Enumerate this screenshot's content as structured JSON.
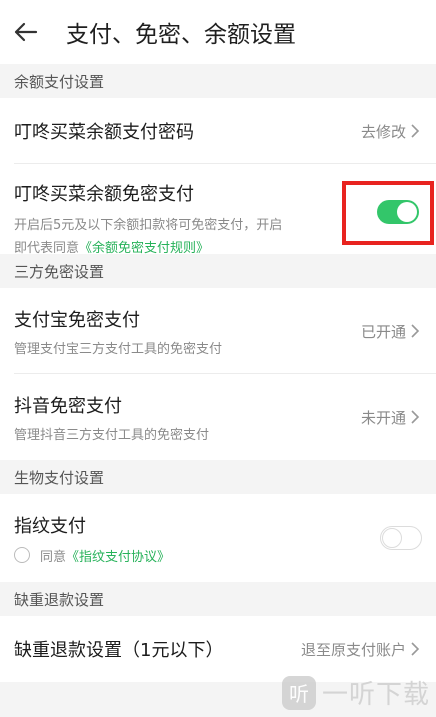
{
  "header": {
    "title": "支付、免密、余额设置",
    "back_icon": "back-arrow-icon"
  },
  "sections": {
    "balance": {
      "label": "余额支付设置",
      "password_row": {
        "title": "叮咚买菜余额支付密码",
        "action": "去修改"
      },
      "free_pay_row": {
        "title": "叮咚买菜余额免密支付",
        "sub_line1": "开启后5元及以下余额扣款将可免密支付，开启",
        "sub_line2_prefix": "即代表同意",
        "sub_line2_link": "《余额免密支付规则》",
        "toggle_on": true
      }
    },
    "third_party": {
      "label": "三方免密设置",
      "alipay": {
        "title": "支付宝免密支付",
        "sub": "管理支付宝三方支付工具的免密支付",
        "status": "已开通"
      },
      "douyin": {
        "title": "抖音免密支付",
        "sub": "管理抖音三方支付工具的免密支付",
        "status": "未开通"
      }
    },
    "biometric": {
      "label": "生物支付设置",
      "fingerprint": {
        "title": "指纹支付",
        "agree_text": "同意",
        "agree_link": "《指纹支付协议》",
        "toggle_on": false
      }
    },
    "refund": {
      "label": "缺重退款设置",
      "row": {
        "title": "缺重退款设置（1元以下）",
        "value": "退至原支付账户"
      }
    }
  },
  "watermark": {
    "logo_glyph": "听",
    "text": "一听下载"
  },
  "colors": {
    "accent_green": "#33c66a",
    "link_green": "#27b25a",
    "highlight_red": "#e8231f"
  }
}
